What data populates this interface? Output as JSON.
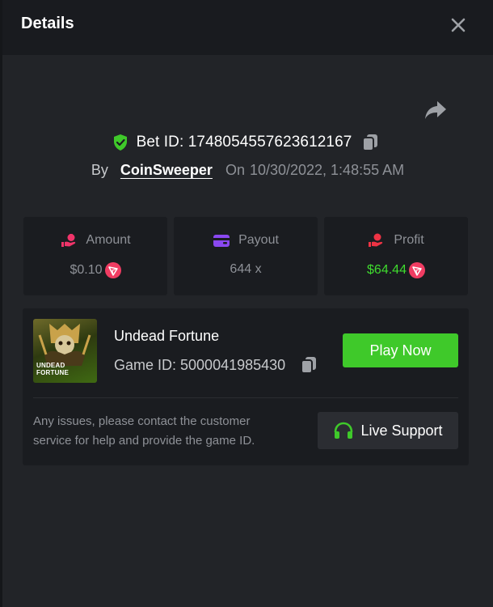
{
  "header": {
    "title": "Details"
  },
  "bet": {
    "id_text": "Bet ID: 1748054557623612167",
    "by_label": "By",
    "username": "CoinSweeper",
    "on_label": "On",
    "date": "10/30/2022, 1:48:55 AM"
  },
  "stats": {
    "amount": {
      "label": "Amount",
      "value": "$0.10",
      "icon": "money-bag-hand-icon"
    },
    "payout": {
      "label": "Payout",
      "value": "644 x",
      "icon": "wallet-card-icon"
    },
    "profit": {
      "label": "Profit",
      "value": "$64.44",
      "icon": "coin-hand-icon"
    }
  },
  "game": {
    "name": "Undead Fortune",
    "id_text": "Game ID: 5000041985430",
    "thumbnail_text": "UNDEAD\nFORTUNE",
    "play_label": "Play Now",
    "help_text": "Any issues, please contact the customer service for help and provide the game ID.",
    "support_label": "Live Support"
  },
  "colors": {
    "accent_green": "#3fc92a",
    "profit_green": "#3fdc2e",
    "amount_icon": "#f0346a",
    "payout_icon": "#8a48f0",
    "profit_icon": "#ee3344",
    "currency_icon": "#f03c62"
  }
}
